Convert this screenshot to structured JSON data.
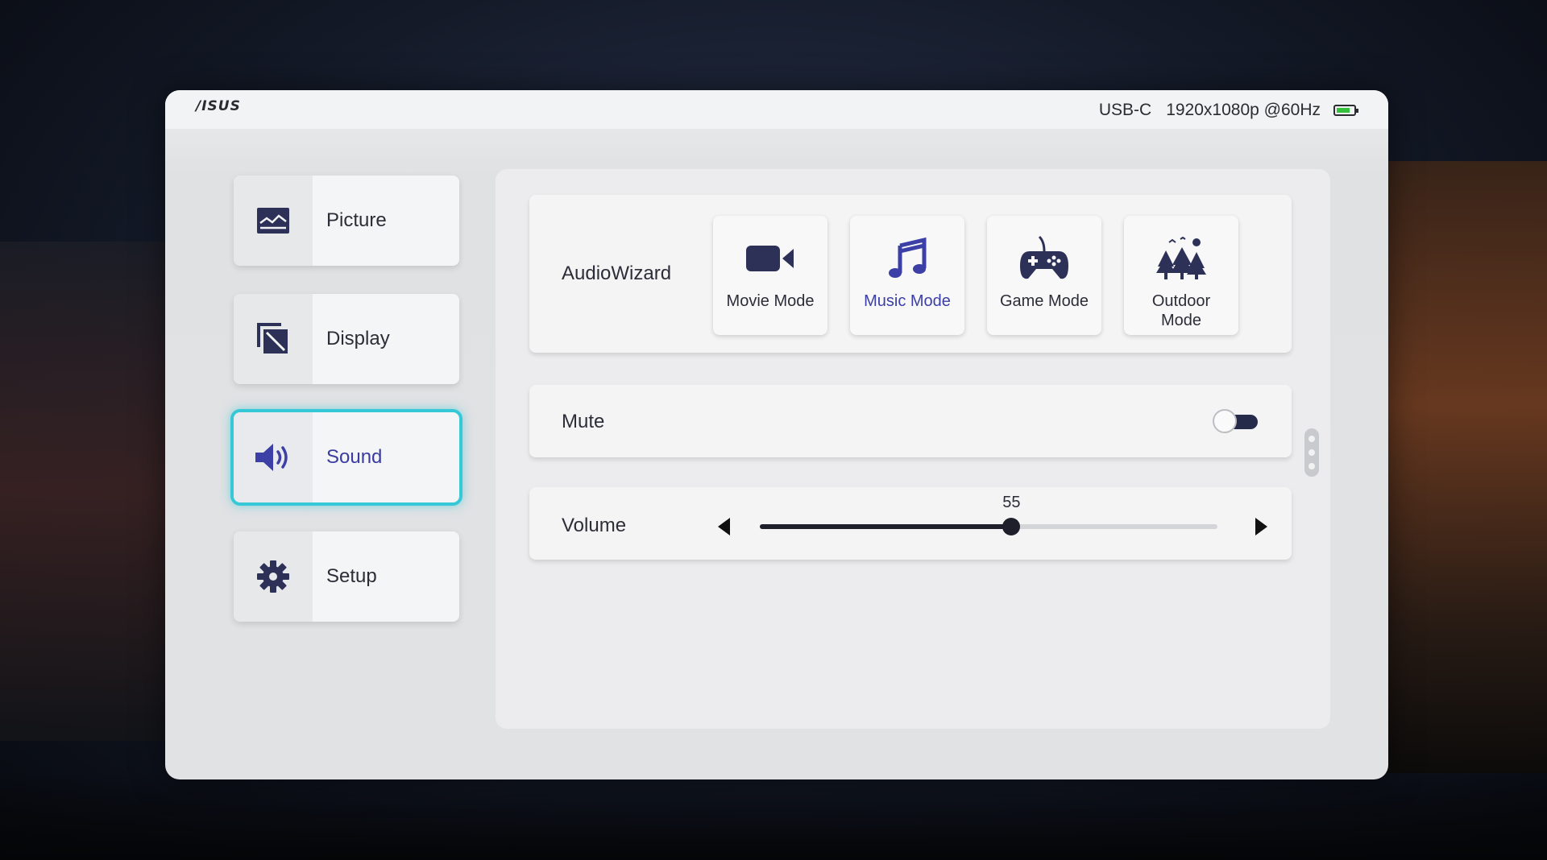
{
  "header": {
    "logo": "/ISUS",
    "input_source": "USB-C",
    "resolution": "1920x1080p @60Hz",
    "battery_icon": "battery-icon"
  },
  "sidebar": {
    "items": [
      {
        "label": "Picture",
        "icon": "picture-icon"
      },
      {
        "label": "Display",
        "icon": "display-icon"
      },
      {
        "label": "Sound",
        "icon": "speaker-icon",
        "active": true
      },
      {
        "label": "Setup",
        "icon": "gear-icon"
      }
    ]
  },
  "audiowizard": {
    "label": "AudioWizard",
    "modes": [
      {
        "label": "Movie Mode",
        "icon": "video-camera-icon"
      },
      {
        "label": "Music Mode",
        "icon": "music-note-icon",
        "selected": true
      },
      {
        "label": "Game Mode",
        "icon": "gamepad-icon"
      },
      {
        "label": "Outdoor Mode",
        "icon": "trees-icon"
      }
    ]
  },
  "mute": {
    "label": "Mute",
    "state": "off"
  },
  "volume": {
    "label": "Volume",
    "value": "55",
    "min": 0,
    "max": 100
  },
  "colors": {
    "accent_highlight": "#37c8d8",
    "selected_text": "#3b3fa6",
    "icon_dark": "#2e3157",
    "battery_fill": "#35c13b"
  }
}
